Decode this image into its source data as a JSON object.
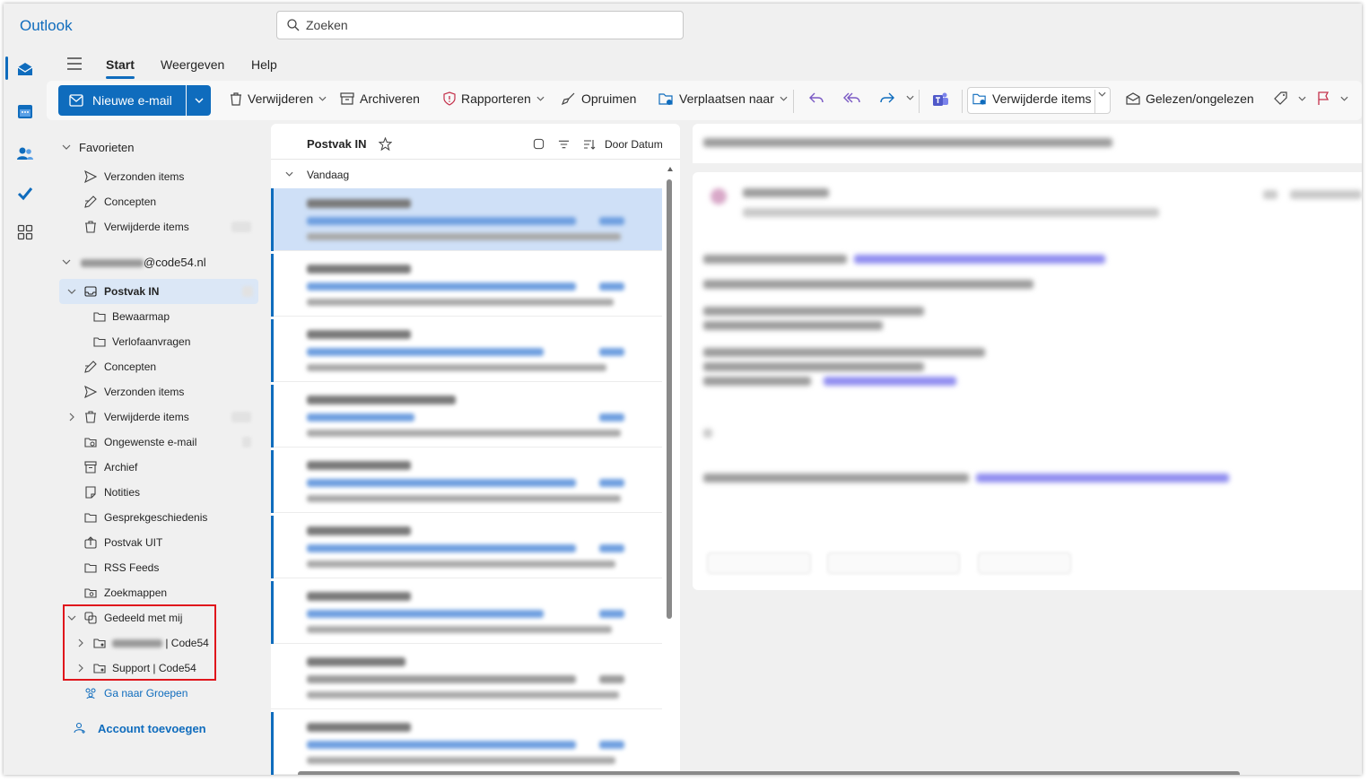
{
  "app": {
    "title": "Outlook"
  },
  "search": {
    "placeholder": "Zoeken"
  },
  "menu": {
    "tabs": [
      "Start",
      "Weergeven",
      "Help"
    ]
  },
  "ribbon": {
    "new_mail": "Nieuwe e-mail",
    "delete": "Verwijderen",
    "archive": "Archiveren",
    "report": "Rapporteren",
    "sweep": "Opruimen",
    "move_to": "Verplaatsen naar",
    "deleted_items": "Verwijderde items",
    "read_unread": "Gelezen/ongelezen"
  },
  "folders": {
    "favorites_header": "Favorieten",
    "favorites": [
      "Verzonden items",
      "Concepten",
      "Verwijderde items"
    ],
    "account_suffix": "@code54.nl",
    "inbox": "Postvak IN",
    "inbox_subfolders": [
      "Bewaarmap",
      "Verlofaanvragen"
    ],
    "items": [
      "Concepten",
      "Verzonden items",
      "Verwijderde items",
      "Ongewenste e-mail",
      "Archief",
      "Notities",
      "Gesprekgeschiedenis",
      "Postvak UIT",
      "RSS Feeds",
      "Zoekmappen"
    ],
    "shared_header": "Gedeeld met mij",
    "shared_1_suffix": "| Code54",
    "shared_2": "Support | Code54",
    "go_groups": "Ga naar Groepen",
    "add_account": "Account toevoegen"
  },
  "message_list": {
    "title": "Postvak IN",
    "sort": "Door Datum",
    "group": "Vandaag"
  },
  "colors": {
    "accent": "#0f6cbd",
    "highlight_box": "#e0161c"
  }
}
